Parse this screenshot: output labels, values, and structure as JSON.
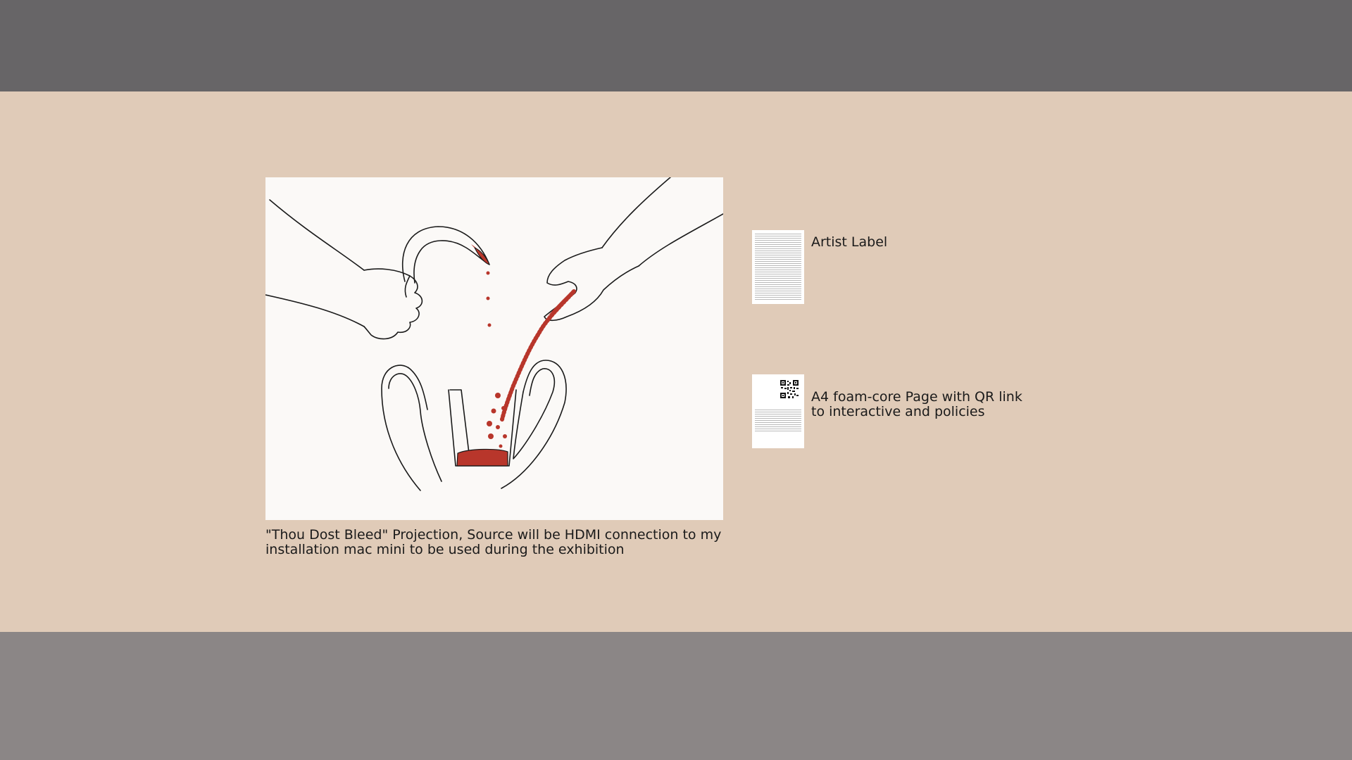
{
  "scene": {
    "colors": {
      "ceiling": "#676567",
      "wall": "#e0cbb8",
      "floor": "#8b8686",
      "projection_background": "#fbf9f7",
      "blood": "#b8362b",
      "line_art": "#1a1a1a"
    }
  },
  "projection": {
    "caption": "\"Thou Dost Bleed\" Projection,  Source will be HDMI connection to my installation mac mini to be used during the exhibition"
  },
  "items": {
    "artist_label": {
      "text": "Artist Label"
    },
    "qr_page": {
      "text": "A4 foam-core Page with QR link to interactive and policies",
      "icon": "qr-code-icon"
    }
  }
}
